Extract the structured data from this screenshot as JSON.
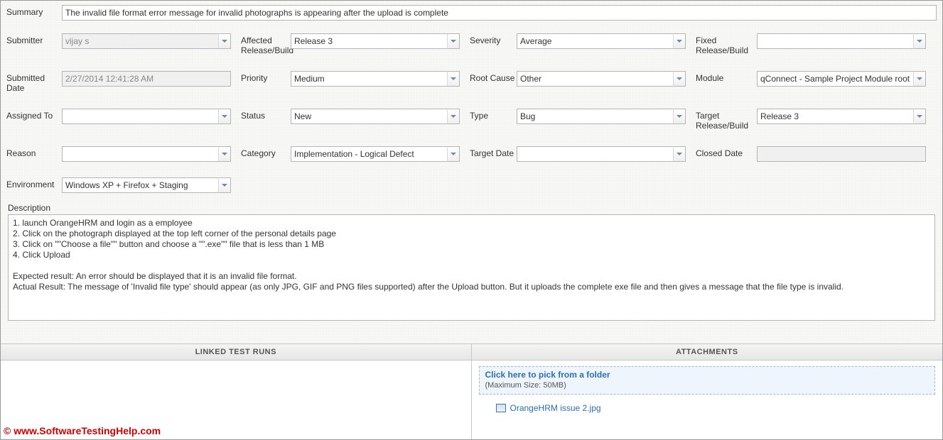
{
  "labels": {
    "summary": "Summary",
    "submitter": "Submitter",
    "affected": "Affected Release/Build",
    "severity": "Severity",
    "fixed": "Fixed Release/Build",
    "submitted_date": "Submitted Date",
    "priority": "Priority",
    "root_cause": "Root Cause",
    "module": "Module",
    "assigned_to": "Assigned To",
    "status": "Status",
    "type": "Type",
    "target_rb": "Target Release/Build",
    "reason": "Reason",
    "category": "Category",
    "target_date": "Target Date",
    "closed_date": "Closed Date",
    "environment": "Environment",
    "description": "Description"
  },
  "values": {
    "summary": "The invalid file format error message for invalid photographs is appearing after the upload is complete",
    "submitter": "vijay s",
    "affected": "Release 3",
    "severity": "Average",
    "fixed": "",
    "submitted_date": "2/27/2014 12:41:28 AM",
    "priority": "Medium",
    "root_cause": "Other",
    "module": "qConnect - Sample Project Module root",
    "assigned_to": "",
    "status": "New",
    "type": "Bug",
    "target_rb": "Release 3",
    "reason": "",
    "category": "Implementation - Logical Defect",
    "target_date": "",
    "closed_date": "",
    "environment": "Windows XP + Firefox + Staging"
  },
  "description_text": "1. launch OrangeHRM and login as a employee\n2. Click on the photograph displayed at the top left corner of the personal details page\n3. Click on \"\"Choose a file\"\" button and choose a \"\".exe\"\" file that is less than 1 MB\n4. Click Upload\n\nExpected result: An error should be displayed that it is an invalid file format.\nActual Result: The message of 'Invalid file type' should appear (as only JPG, GIF and PNG files supported) after the Upload button. But it uploads the complete exe file and then gives a message that the file type is invalid.",
  "panels": {
    "linked_runs_title": "LINKED TEST RUNS",
    "attachments_title": "ATTACHMENTS",
    "pick_link": "Click here to pick from a folder",
    "max_size": "(Maximum Size: 50MB)",
    "attachment_name": "OrangeHRM issue 2.jpg"
  },
  "watermark": "© www.SoftwareTestingHelp.com"
}
